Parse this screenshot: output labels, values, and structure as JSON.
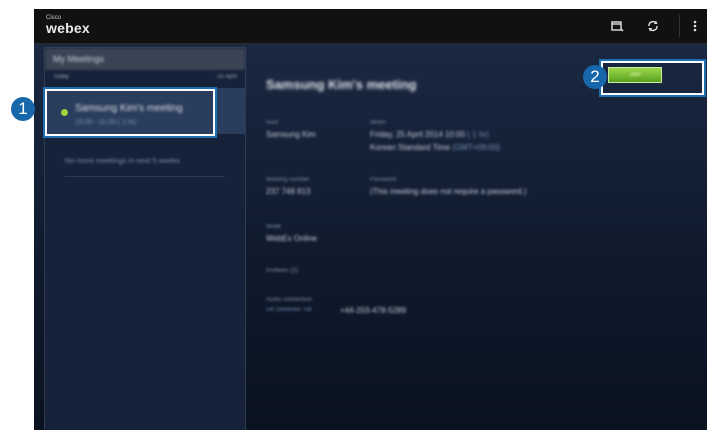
{
  "app": {
    "brand_small": "Cisco",
    "brand": "webex"
  },
  "toolbar": {
    "icons": [
      "calendar-icon",
      "refresh-icon",
      "more-vert-icon"
    ]
  },
  "sidebar": {
    "title": "My Meetings",
    "header_left": "Today",
    "header_right": "25 April",
    "meeting": {
      "name": "Samsung Kim's meeting",
      "time": "10:00 - 11:00 ( 1 hr)"
    },
    "empty_note": "No more meetings in next 5 weeks"
  },
  "detail": {
    "title": "Samsung Kim's meeting",
    "host_label": "Host",
    "host": "Samsung Kim",
    "when_label": "When",
    "when_line1": "Friday, 25 April 2014 10:00",
    "when_line1_extra": "( 1 hr)",
    "when_line2": "Korean Standard Time",
    "when_line2_extra": "(GMT+09:00)",
    "meeting_number_label": "Meeting number",
    "meeting_number": "237 748 813",
    "password_label": "Password",
    "password": "(This meeting does not require a password.)",
    "mode_label": "Mode",
    "mode": "WebEx Online",
    "invitees": "Invitees (2)",
    "audio_label": "Audio connection",
    "audio_extra": "UK Domestic Toll",
    "audio_number": "+44-203-478-5289",
    "join_label": "Join"
  },
  "callouts": [
    "1",
    "2"
  ],
  "colors": {
    "accent": "#1767aa",
    "join_green": "#6bb52a",
    "dot": "#9ed33c"
  }
}
